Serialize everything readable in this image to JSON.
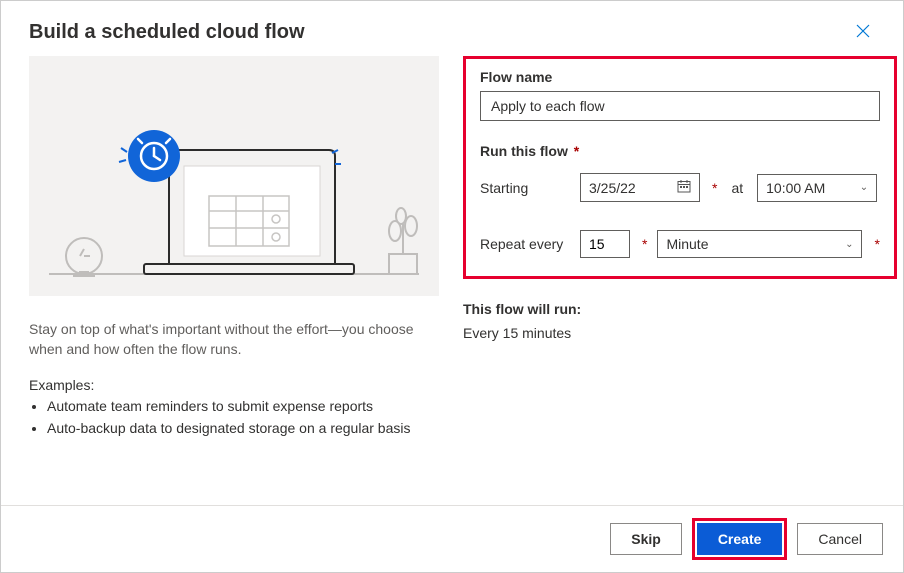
{
  "dialogTitle": "Build a scheduled cloud flow",
  "illustrationAlt": "Laptop with scheduled calendar illustration",
  "description": "Stay on top of what's important without the effort—you choose when and how often the flow runs.",
  "examplesLabel": "Examples:",
  "examples": [
    "Automate team reminders to submit expense reports",
    "Auto-backup data to designated storage on a regular basis"
  ],
  "form": {
    "nameLabel": "Flow name",
    "nameValue": "Apply to each flow",
    "runLabel": "Run this flow",
    "startingLabel": "Starting",
    "dateValue": "3/25/22",
    "atLabel": "at",
    "timeValue": "10:00 AM",
    "repeatLabel": "Repeat every",
    "intervalValue": "15",
    "unitValue": "Minute"
  },
  "summary": {
    "heading": "This flow will run:",
    "text": "Every 15 minutes"
  },
  "buttons": {
    "skip": "Skip",
    "create": "Create",
    "cancel": "Cancel"
  }
}
